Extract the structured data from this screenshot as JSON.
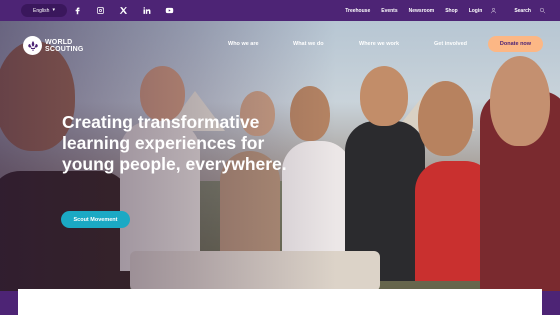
{
  "topbar": {
    "language": "English",
    "social": [
      "facebook-icon",
      "instagram-icon",
      "x-icon",
      "linkedin-icon",
      "youtube-icon"
    ],
    "links": [
      "Treehouse",
      "Events",
      "Newsroom",
      "Shop"
    ],
    "login": "Login",
    "search": "Search"
  },
  "brand": {
    "line1": "WORLD",
    "line2": "SCOUTING"
  },
  "nav": {
    "items": [
      "Who we are",
      "What we do",
      "Where we work",
      "Get involved"
    ],
    "donate": "Donate now"
  },
  "hero": {
    "headline": "Creating transformative learning experiences for young people, everywhere.",
    "cta": "Scout Movement"
  },
  "colors": {
    "brand_purple": "#4d2475",
    "accent_peach": "#fcb785",
    "accent_teal": "#1ba9c4"
  }
}
